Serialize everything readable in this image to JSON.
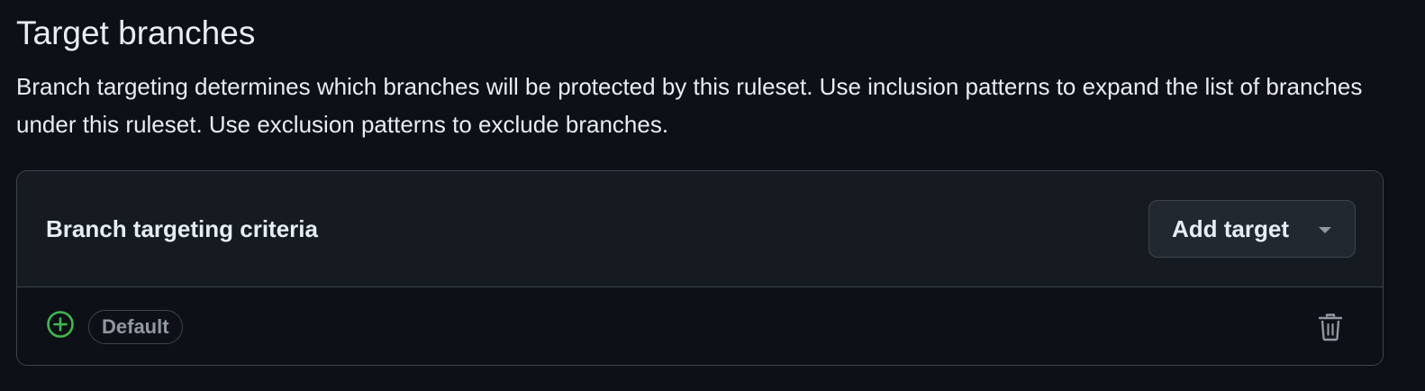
{
  "section": {
    "title": "Target branches",
    "description": "Branch targeting determines which branches will be protected by this ruleset. Use inclusion patterns to expand the list of branches under this ruleset. Use exclusion patterns to exclude branches."
  },
  "criteria": {
    "title": "Branch targeting criteria",
    "add_target_label": "Add target",
    "add_target_icon": "triangle-down-icon",
    "targets": [
      {
        "icon": "plus-circle-icon",
        "badge": "Default",
        "delete_icon": "trash-icon"
      }
    ]
  },
  "colors": {
    "background": "#0d1117",
    "header_background": "#161b22",
    "border": "#3d444d",
    "text": "#e6edf3",
    "muted_text": "#9198a1",
    "success_green": "#3fb950"
  }
}
